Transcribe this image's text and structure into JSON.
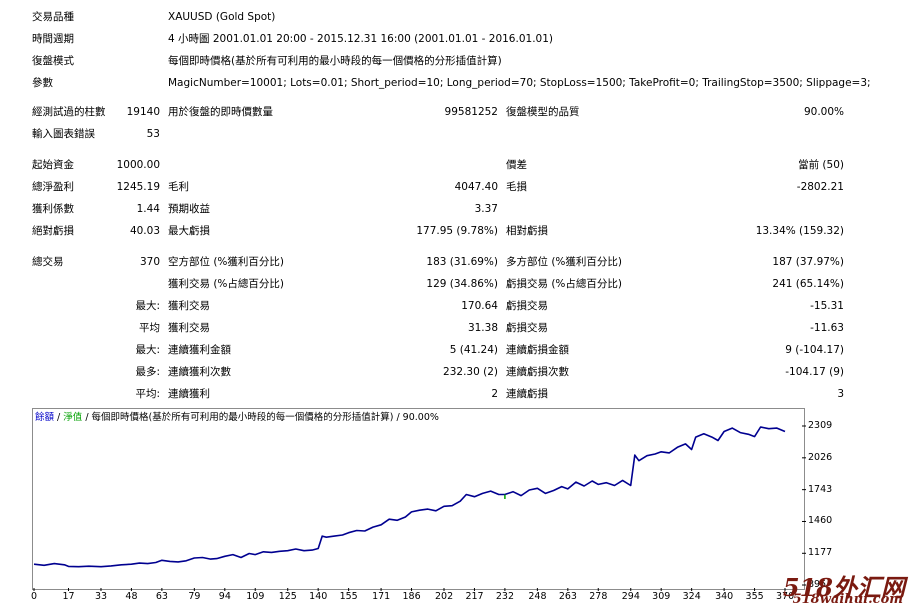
{
  "header": [
    {
      "label": "交易品種",
      "value": "XAUUSD (Gold Spot)"
    },
    {
      "label": "時間週期",
      "value": "4 小時圖 2001.01.01 20:00 - 2015.12.31 16:00 (2001.01.01 - 2016.01.01)"
    },
    {
      "label": "復盤模式",
      "value": "每個即時價格(基於所有可利用的最小時段的每一個價格的分形插值計算)"
    },
    {
      "label": "參數",
      "value": "MagicNumber=10001; Lots=0.01; Short_period=10; Long_period=70; StopLoss=1500; TakeProfit=0; TrailingStop=3500; Slippage=3;"
    }
  ],
  "test_rows": [
    {
      "l1": "經測試過的柱數",
      "v1": "19140",
      "l2": "用於復盤的即時價數量",
      "v2": "99581252",
      "l3": "復盤模型的品質",
      "v3": "90.00%"
    },
    {
      "l1": "輸入圖表錯誤",
      "v1": "53",
      "l2": "",
      "v2": "",
      "l3": "",
      "v3": ""
    }
  ],
  "money_rows": [
    {
      "l1": "起始資金",
      "v1": "1000.00",
      "l2": "",
      "v2": "",
      "l3": "價差",
      "v3": "當前 (50)"
    },
    {
      "l1": "總淨盈利",
      "v1": "1245.19",
      "l2": "毛利",
      "v2": "4047.40",
      "l3": "毛損",
      "v3": "-2802.21"
    },
    {
      "l1": "獲利係數",
      "v1": "1.44",
      "l2": "預期收益",
      "v2": "3.37",
      "l3": "",
      "v3": ""
    },
    {
      "l1": "絕對虧損",
      "v1": "40.03",
      "l2": "最大虧損",
      "v2": "177.95 (9.78%)",
      "l3": "相對虧損",
      "v3": "13.34% (159.32)"
    }
  ],
  "trade_rows": [
    {
      "l1": "總交易",
      "v1": "370",
      "l2": "空方部位 (%獲利百分比)",
      "v2": "183 (31.69%)",
      "l3": "多方部位 (%獲利百分比)",
      "v3": "187 (37.97%)"
    },
    {
      "l1": "",
      "v1": "",
      "l2": "獲利交易 (%占總百分比)",
      "v2": "129 (34.86%)",
      "l3": "虧損交易 (%占總百分比)",
      "v3": "241 (65.14%)"
    },
    {
      "l1": "",
      "v1": "最大:",
      "l2": "獲利交易",
      "v2": "170.64",
      "l3": "虧損交易",
      "v3": "-15.31"
    },
    {
      "l1": "",
      "v1": "平均",
      "l2": "獲利交易",
      "v2": "31.38",
      "l3": "虧損交易",
      "v3": "-11.63"
    },
    {
      "l1": "",
      "v1": "最大:",
      "l2": "連續獲利金額",
      "v2": "5 (41.24)",
      "l3": "連續虧損金額",
      "v3": "9 (-104.17)"
    },
    {
      "l1": "",
      "v1": "最多:",
      "l2": "連續獲利次數",
      "v2": "232.30 (2)",
      "l3": "連續虧損次數",
      "v3": "-104.17 (9)"
    },
    {
      "l1": "",
      "v1": "平均:",
      "l2": "連續獲利",
      "v2": "2",
      "l3": "連續虧損",
      "v3": "3"
    }
  ],
  "legend": {
    "balance": "餘額",
    "equity": "淨值",
    "text": "/ 每個即時價格(基於所有可利用的最小時段的每一個價格的分形插值計算) / 90.00%"
  },
  "watermark": {
    "big": "518外汇网",
    "small": "518waihui.com"
  },
  "colors": {
    "balance": "#000090",
    "equity": "#00a000",
    "axis": "#000000"
  },
  "chart_data": {
    "type": "line",
    "xlabel": "",
    "ylabel": "",
    "x_ticks": [
      "0",
      "17",
      "33",
      "48",
      "63",
      "79",
      "94",
      "109",
      "125",
      "140",
      "155",
      "171",
      "186",
      "202",
      "217",
      "232",
      "248",
      "263",
      "278",
      "294",
      "309",
      "324",
      "340",
      "355",
      "370"
    ],
    "y_ticks": [
      "2309",
      "2026",
      "1743",
      "1460",
      "1177",
      "895"
    ],
    "ylim": [
      895,
      2400
    ],
    "xlim": [
      0,
      370
    ],
    "series": [
      {
        "name": "餘額",
        "x": [
          0,
          5,
          10,
          15,
          17,
          22,
          27,
          33,
          38,
          43,
          48,
          52,
          56,
          60,
          63,
          67,
          71,
          75,
          79,
          83,
          87,
          90,
          94,
          98,
          102,
          106,
          109,
          113,
          117,
          121,
          125,
          129,
          133,
          137,
          140,
          142,
          144,
          148,
          152,
          155,
          159,
          163,
          167,
          171,
          175,
          179,
          183,
          186,
          190,
          194,
          198,
          202,
          206,
          210,
          213,
          217,
          221,
          225,
          229,
          232,
          236,
          240,
          244,
          248,
          252,
          256,
          260,
          263,
          267,
          271,
          275,
          278,
          282,
          286,
          290,
          294,
          296,
          298,
          302,
          306,
          309,
          313,
          317,
          321,
          324,
          326,
          330,
          334,
          337,
          340,
          344,
          348,
          352,
          355,
          358,
          362,
          366,
          370
        ],
        "y": [
          1080,
          1070,
          1085,
          1075,
          1060,
          1058,
          1062,
          1058,
          1065,
          1075,
          1080,
          1090,
          1085,
          1095,
          1115,
          1105,
          1100,
          1110,
          1135,
          1140,
          1125,
          1130,
          1150,
          1165,
          1140,
          1175,
          1165,
          1190,
          1185,
          1195,
          1200,
          1215,
          1200,
          1205,
          1220,
          1330,
          1320,
          1330,
          1340,
          1360,
          1380,
          1375,
          1410,
          1430,
          1480,
          1470,
          1500,
          1545,
          1560,
          1570,
          1555,
          1595,
          1600,
          1640,
          1700,
          1680,
          1710,
          1730,
          1700,
          1700,
          1725,
          1690,
          1740,
          1755,
          1710,
          1735,
          1770,
          1750,
          1810,
          1775,
          1820,
          1790,
          1805,
          1780,
          1825,
          1780,
          2050,
          2000,
          2045,
          2060,
          2080,
          2070,
          2120,
          2150,
          2100,
          2210,
          2240,
          2210,
          2180,
          2260,
          2290,
          2250,
          2235,
          2215,
          2300,
          2285,
          2290,
          2260
        ]
      }
    ]
  }
}
